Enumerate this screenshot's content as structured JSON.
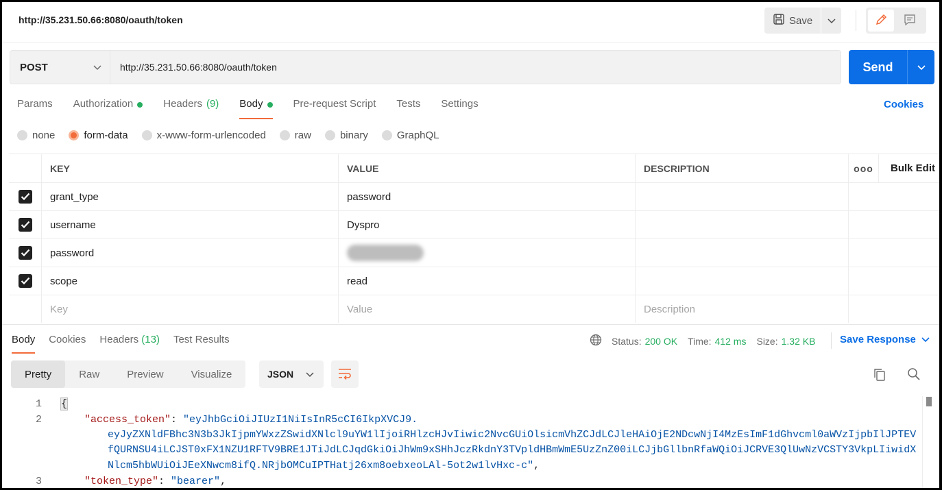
{
  "window": {
    "title": "http://35.231.50.66:8080/oauth/token",
    "save_label": "Save"
  },
  "request": {
    "method": "POST",
    "url": "http://35.231.50.66:8080/oauth/token",
    "send_label": "Send"
  },
  "request_tabs": {
    "params": "Params",
    "authorization": "Authorization",
    "headers": "Headers",
    "headers_count": "(9)",
    "body": "Body",
    "prerequest": "Pre-request Script",
    "tests": "Tests",
    "settings": "Settings",
    "cookies": "Cookies"
  },
  "body_types": {
    "none": "none",
    "form_data": "form-data",
    "urlencoded": "x-www-form-urlencoded",
    "raw": "raw",
    "binary": "binary",
    "graphql": "GraphQL",
    "selected": "form-data"
  },
  "params_table": {
    "headers": {
      "key": "KEY",
      "value": "VALUE",
      "description": "DESCRIPTION",
      "more": "ooo",
      "bulk_edit": "Bulk Edit"
    },
    "rows": [
      {
        "checked": true,
        "key": "grant_type",
        "value": "password",
        "description": ""
      },
      {
        "checked": true,
        "key": "username",
        "value": "Dyspro",
        "description": ""
      },
      {
        "checked": true,
        "key": "password",
        "value": "",
        "description": ""
      },
      {
        "checked": true,
        "key": "scope",
        "value": "read",
        "description": ""
      }
    ],
    "placeholders": {
      "key": "Key",
      "value": "Value",
      "description": "Description"
    }
  },
  "response": {
    "tabs": {
      "body": "Body",
      "cookies": "Cookies",
      "headers": "Headers",
      "headers_count": "(13)",
      "test_results": "Test Results"
    },
    "status_label": "Status:",
    "status_value": "200 OK",
    "time_label": "Time:",
    "time_value": "412 ms",
    "size_label": "Size:",
    "size_value": "1.32 KB",
    "save_response": "Save Response",
    "view_modes": {
      "pretty": "Pretty",
      "raw": "Raw",
      "preview": "Preview",
      "visualize": "Visualize"
    },
    "format": "JSON"
  },
  "code": {
    "line_numbers": [
      "1",
      "2",
      "3"
    ],
    "line1": "{",
    "line2_key": "\"access_token\"",
    "line2_sep": ": ",
    "line2_val_a": "\"eyJhbGciOiJIUzI1NiIsInR5cCI6IkpXVCJ9.",
    "line2_val_b": "eyJyZXNldFBhc3N3b3JkIjpmYWxzZSwidXNlcl9uYW1lIjoiRHlzcHJvIiwic2NvcGUiOlsicmVhZCJdLCJleHAiOjE2NDcwNjI4MzEsImF1dGhvcml0aWVzIjpbIlJPTEV",
    "line2_val_c": "fQURNSU4iLCJST0xFX1NZU1RFTV9BRE1JTiJdLCJqdGkiOiJhWm9xSHhJczRkdnY3TVpldHBmWmE5UzZnZ00iLCJjbGllbnRfaWQiOiJCRVE3QlUwNzVCSTY3VkpLIiwidX",
    "line2_val_d": "Nlcm5hbWUiOiJEeXNwcm8ifQ.NRjbOMCuIPTHatj26xm8oebxeoLAl-5ot2w1lvHxc-c\"",
    "line2_end": ",",
    "line3_key": "\"token_type\"",
    "line3_sep": ": ",
    "line3_val": "\"bearer\"",
    "line3_end": ","
  },
  "colors": {
    "accent_orange": "#f26b3a",
    "send_blue": "#0b6ee6",
    "status_green": "#27ae60"
  }
}
